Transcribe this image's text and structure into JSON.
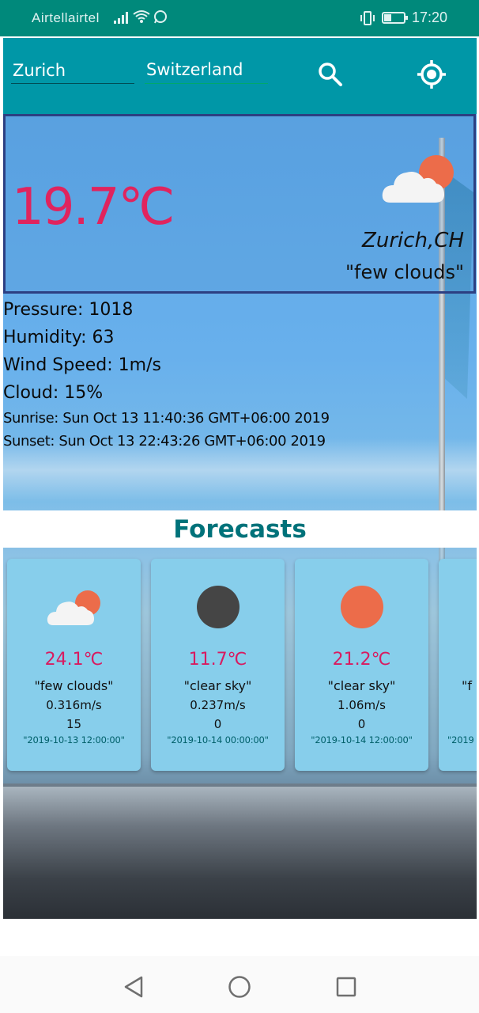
{
  "status_bar": {
    "carrier": "Airtellairtel",
    "time": "17:20",
    "battery_level": 0.35
  },
  "header": {
    "city_value": "Zurich",
    "country_value": "Switzerland",
    "search_icon": "search-icon",
    "locate_icon": "gps-locate-icon"
  },
  "current": {
    "temperature": "19.7℃",
    "location": "Zurich,CH",
    "condition": "\"few clouds\"",
    "icon": "cloud-sun-icon",
    "colors": {
      "temperature": "#e0245e",
      "box_border": "#2c3f82"
    }
  },
  "details": {
    "pressure": "Pressure: 1018",
    "humidity": "Humidity: 63",
    "wind_speed": "Wind Speed: 1m/s",
    "cloud": "Cloud: 15%",
    "sunrise": "Sunrise: Sun Oct 13 11:40:36 GMT+06:00 2019",
    "sunset": "Sunset: Sun Oct 13 22:43:26 GMT+06:00 2019"
  },
  "forecasts": {
    "title": "Forecasts",
    "cards": [
      {
        "icon": "cloud-sun-icon",
        "temperature": "24.1℃",
        "condition": "\"few clouds\"",
        "wind": "0.316m/s",
        "clouds": "15",
        "date": "\"2019-10-13 12:00:00\""
      },
      {
        "icon": "moon-icon",
        "temperature": "11.7℃",
        "condition": "\"clear sky\"",
        "wind": "0.237m/s",
        "clouds": "0",
        "date": "\"2019-10-14 00:00:00\""
      },
      {
        "icon": "sun-icon",
        "temperature": "21.2℃",
        "condition": "\"clear sky\"",
        "wind": "1.06m/s",
        "clouds": "0",
        "date": "\"2019-10-14 12:00:00\""
      },
      {
        "icon": "unknown",
        "temperature": "",
        "condition": "\"f",
        "wind": "",
        "clouds": "",
        "date": "\"2019"
      }
    ]
  },
  "nav": {
    "back_icon": "back-triangle-icon",
    "home_icon": "home-circle-icon",
    "recents_icon": "recents-square-icon"
  }
}
